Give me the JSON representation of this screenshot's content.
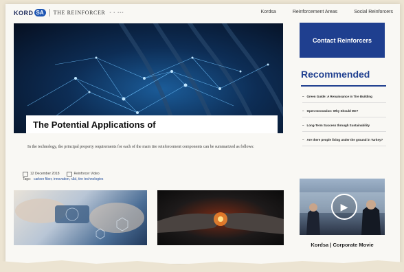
{
  "header": {
    "logo_word": "KORD",
    "logo_badge": "SA",
    "site_title": "THE REINFORCER",
    "nav": [
      "Kordsa",
      "Reinforcement Areas",
      "Social Reinforcers"
    ]
  },
  "article": {
    "headline": "The Potential Applications of",
    "lead": "In the technology, the principal property requirements for each of the main tire reinforcement components can be summarized as follows:",
    "date": "12 December 2018",
    "author": "Reinforcer Video",
    "tags_label": "Tags:",
    "tags": "carbon fiber, innovation, r&d, tire technologies"
  },
  "sidebar": {
    "contact_label": "Contact Reinforcers",
    "recommended_title": "Recommended",
    "recommended": [
      "Green Guide: A Renaissance in Tire Building",
      "Open Innovation: Why Should We?",
      "Long-Term Success through Sustainability",
      "Are there people living under the ground in Turkey?"
    ],
    "video_caption": "Kordsa | Corporate Movie"
  },
  "colors": {
    "brand_blue": "#1f3f8f",
    "paper": "#f9f8f4"
  }
}
